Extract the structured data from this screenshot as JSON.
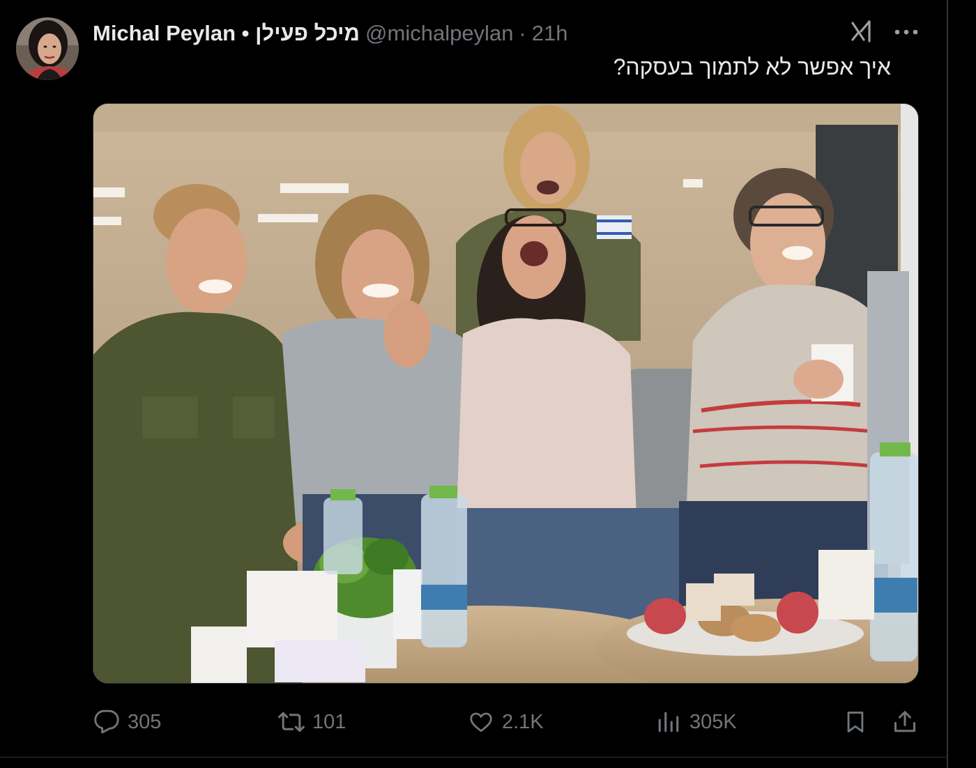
{
  "author": {
    "display_name": "Michal Peylan • מיכל פעילן",
    "handle": "@michalpeylan",
    "separator": "·",
    "time": "21h"
  },
  "tweet": {
    "text": "איך אפשר לא לתמוך בעסקה?"
  },
  "media": {
    "kind": "photo",
    "alt": ""
  },
  "actions": {
    "reply_count": "305",
    "retweet_count": "101",
    "like_count": "2.1K",
    "views_count": "305K"
  },
  "icons": {
    "reply": "reply-icon",
    "retweet": "retweet-icon",
    "like": "like-icon",
    "views": "views-icon",
    "bookmark": "bookmark-icon",
    "share": "share-icon",
    "grok": "grok-icon",
    "more": "more-icon"
  },
  "colors": {
    "background": "#000000",
    "text": "#e7e9ea",
    "muted": "#71767b",
    "border": "#2f3336"
  }
}
